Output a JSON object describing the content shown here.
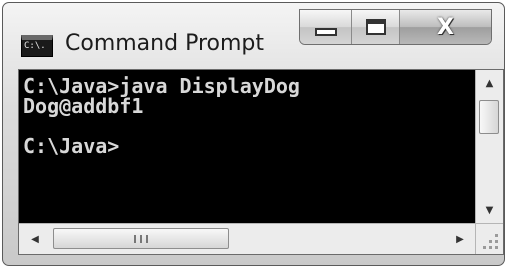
{
  "window": {
    "title": "Command Prompt",
    "icon": "cmd-app-icon",
    "icon_text": "C:\\."
  },
  "controls": {
    "minimize_icon": "minimize-icon",
    "maximize_icon": "maximize-icon",
    "close_icon": "close-icon",
    "close_glyph": "X"
  },
  "console": {
    "lines": [
      "C:\\Java>java DisplayDog",
      "Dog@addbf1",
      "",
      "C:\\Java>"
    ],
    "text_color": "#d8d8d8",
    "background_color": "#000000"
  },
  "scrollbars": {
    "up_arrow": "▲",
    "down_arrow": "▼",
    "left_arrow": "◀",
    "right_arrow": "▶"
  }
}
